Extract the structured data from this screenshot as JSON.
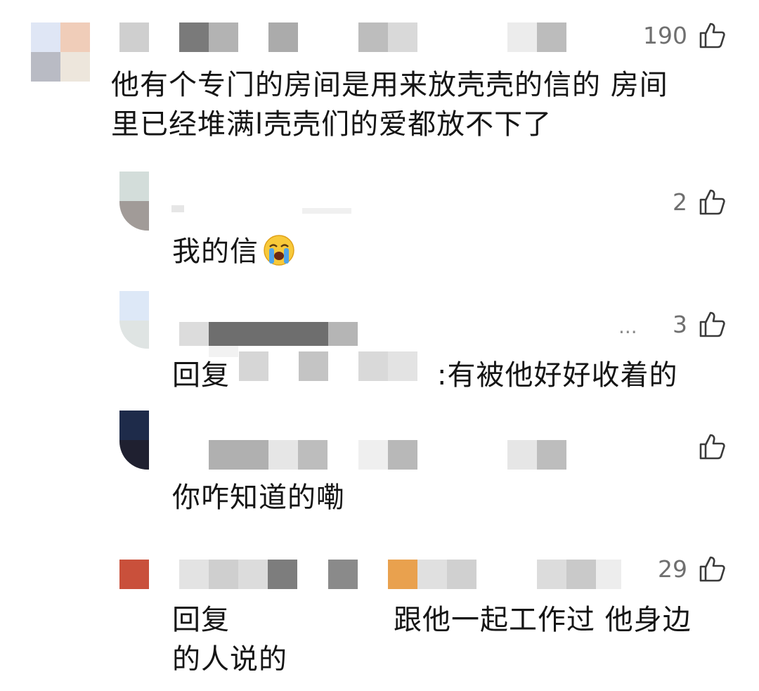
{
  "comments": [
    {
      "text_lines": [
        "他有个专门的房间是用来放壳壳的信的 房间",
        "里已经堆满l壳壳们的爱都放不下了"
      ],
      "likes": "190",
      "icon": "thumbs-up-icon"
    },
    {
      "text": "我的信",
      "emoji": "loudly-crying-face",
      "likes": "2",
      "icon": "thumbs-up-icon"
    },
    {
      "reply_prefix": "回复",
      "reply_body": ":有被他好好收着的",
      "truncated_meta": "...",
      "likes": "3",
      "icon": "thumbs-up-icon"
    },
    {
      "text": "你咋知道的嘞",
      "likes": "",
      "icon": "thumbs-up-icon"
    },
    {
      "reply_prefix": "回复",
      "reply_body": "跟他一起工作过 他身边",
      "text_line2": "的人说的",
      "likes": "29",
      "icon": "thumbs-up-icon"
    }
  ],
  "colors": {
    "text": "#151515",
    "like_count": "#6f6f6f",
    "mosaic_gray": "#b5b5b5",
    "mosaic_dark": "#6e6e6e",
    "mosaic_red": "#c9503b",
    "mosaic_orange": "#e9a14e",
    "avatar_navy": "#1e2b4a"
  }
}
